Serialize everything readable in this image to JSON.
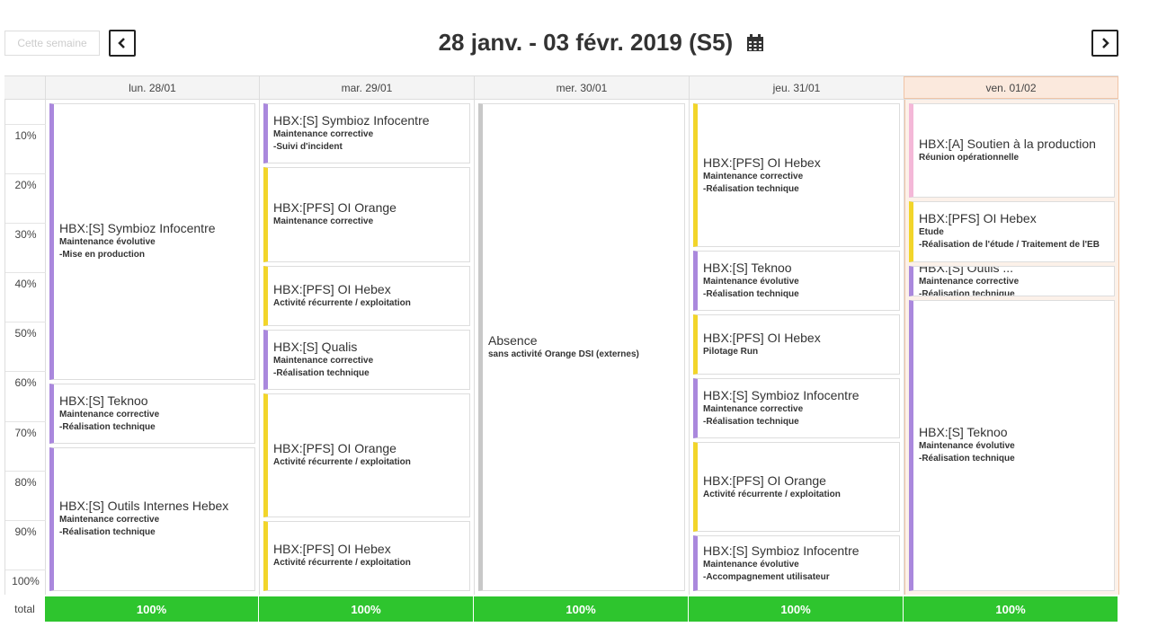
{
  "toolbar": {
    "this_week_label": "Cette semaine",
    "prev_icon": "chevron-left-icon",
    "next_icon": "chevron-right-icon",
    "title": "28 janv. - 03 févr. 2019 (S5)",
    "calendar_icon": "calendar-icon"
  },
  "ticks": [
    "10%",
    "20%",
    "30%",
    "40%",
    "50%",
    "60%",
    "70%",
    "80%",
    "90%",
    "100%"
  ],
  "days": [
    {
      "label": "lun. 28/01",
      "today": false,
      "events": [
        {
          "title": "HBX:[S] Symbioz Infocentre",
          "lines": [
            "Maintenance évolutive",
            "-Mise en production"
          ],
          "color": "purple",
          "start": 0,
          "end": 57
        },
        {
          "title": "HBX:[S] Teknoo",
          "lines": [
            "Maintenance corrective",
            "-Réalisation technique"
          ],
          "color": "purple",
          "start": 57,
          "end": 70
        },
        {
          "title": "HBX:[S] Outils Internes Hebex",
          "lines": [
            "Maintenance corrective",
            "-Réalisation technique"
          ],
          "color": "purple",
          "start": 70,
          "end": 100
        }
      ]
    },
    {
      "label": "mar. 29/01",
      "today": false,
      "events": [
        {
          "title": "HBX:[S] Symbioz Infocentre",
          "lines": [
            "Maintenance corrective",
            "-Suivi d'incident"
          ],
          "color": "purple",
          "start": 0,
          "end": 13
        },
        {
          "title": "HBX:[PFS] OI Orange",
          "lines": [
            "Maintenance corrective"
          ],
          "color": "yellow",
          "start": 13,
          "end": 33
        },
        {
          "title": "HBX:[PFS] OI Hebex",
          "lines": [
            "Activité récurrente / exploitation"
          ],
          "color": "yellow",
          "start": 33,
          "end": 46
        },
        {
          "title": "HBX:[S] Qualis",
          "lines": [
            "Maintenance corrective",
            "-Réalisation technique"
          ],
          "color": "purple",
          "start": 46,
          "end": 59
        },
        {
          "title": "HBX:[PFS] OI Orange",
          "lines": [
            "Activité récurrente / exploitation"
          ],
          "color": "yellow",
          "start": 59,
          "end": 85
        },
        {
          "title": "HBX:[PFS] OI Hebex",
          "lines": [
            "Activité récurrente / exploitation"
          ],
          "color": "yellow",
          "start": 85,
          "end": 100
        }
      ]
    },
    {
      "label": "mer. 30/01",
      "today": false,
      "events": [
        {
          "title": "Absence",
          "lines": [
            "sans activité Orange DSI (externes)"
          ],
          "color": "gray",
          "start": 0,
          "end": 100
        }
      ]
    },
    {
      "label": "jeu. 31/01",
      "today": false,
      "events": [
        {
          "title": "HBX:[PFS] OI Hebex",
          "lines": [
            "Maintenance corrective",
            "-Réalisation technique"
          ],
          "color": "yellow",
          "start": 0,
          "end": 30
        },
        {
          "title": "HBX:[S] Teknoo",
          "lines": [
            "Maintenance évolutive",
            "-Réalisation technique"
          ],
          "color": "purple",
          "start": 30,
          "end": 43
        },
        {
          "title": "HBX:[PFS] OI Hebex",
          "lines": [
            "Pilotage Run"
          ],
          "color": "yellow",
          "start": 43,
          "end": 56
        },
        {
          "title": "HBX:[S] Symbioz Infocentre",
          "lines": [
            "Maintenance corrective",
            "-Réalisation technique"
          ],
          "color": "purple",
          "start": 56,
          "end": 69
        },
        {
          "title": "HBX:[PFS] OI Orange",
          "lines": [
            "Activité récurrente / exploitation"
          ],
          "color": "yellow",
          "start": 69,
          "end": 88
        },
        {
          "title": "HBX:[S] Symbioz Infocentre",
          "lines": [
            "Maintenance évolutive",
            "-Accompagnement utilisateur"
          ],
          "color": "purple",
          "start": 88,
          "end": 100
        }
      ]
    },
    {
      "label": "ven. 01/02",
      "today": true,
      "events": [
        {
          "title": "HBX:[A] Soutien à la production",
          "lines": [
            "Réunion opérationnelle"
          ],
          "color": "pink",
          "start": 0,
          "end": 20
        },
        {
          "title": "HBX:[PFS] OI Hebex",
          "lines": [
            "Etude",
            "-Réalisation de l'étude / Traitement de l'EB"
          ],
          "color": "yellow",
          "start": 20,
          "end": 33
        },
        {
          "title": "HBX:[S] Outils ...",
          "lines": [
            "Maintenance corrective",
            "-Réalisation technique"
          ],
          "color": "purple",
          "start": 33,
          "end": 40
        },
        {
          "title": "HBX:[S] Teknoo",
          "lines": [
            "Maintenance évolutive",
            "-Réalisation technique"
          ],
          "color": "purple",
          "start": 40,
          "end": 100
        }
      ]
    }
  ],
  "totals": {
    "label": "total",
    "values": [
      "100%",
      "100%",
      "100%",
      "100%",
      "100%"
    ]
  }
}
